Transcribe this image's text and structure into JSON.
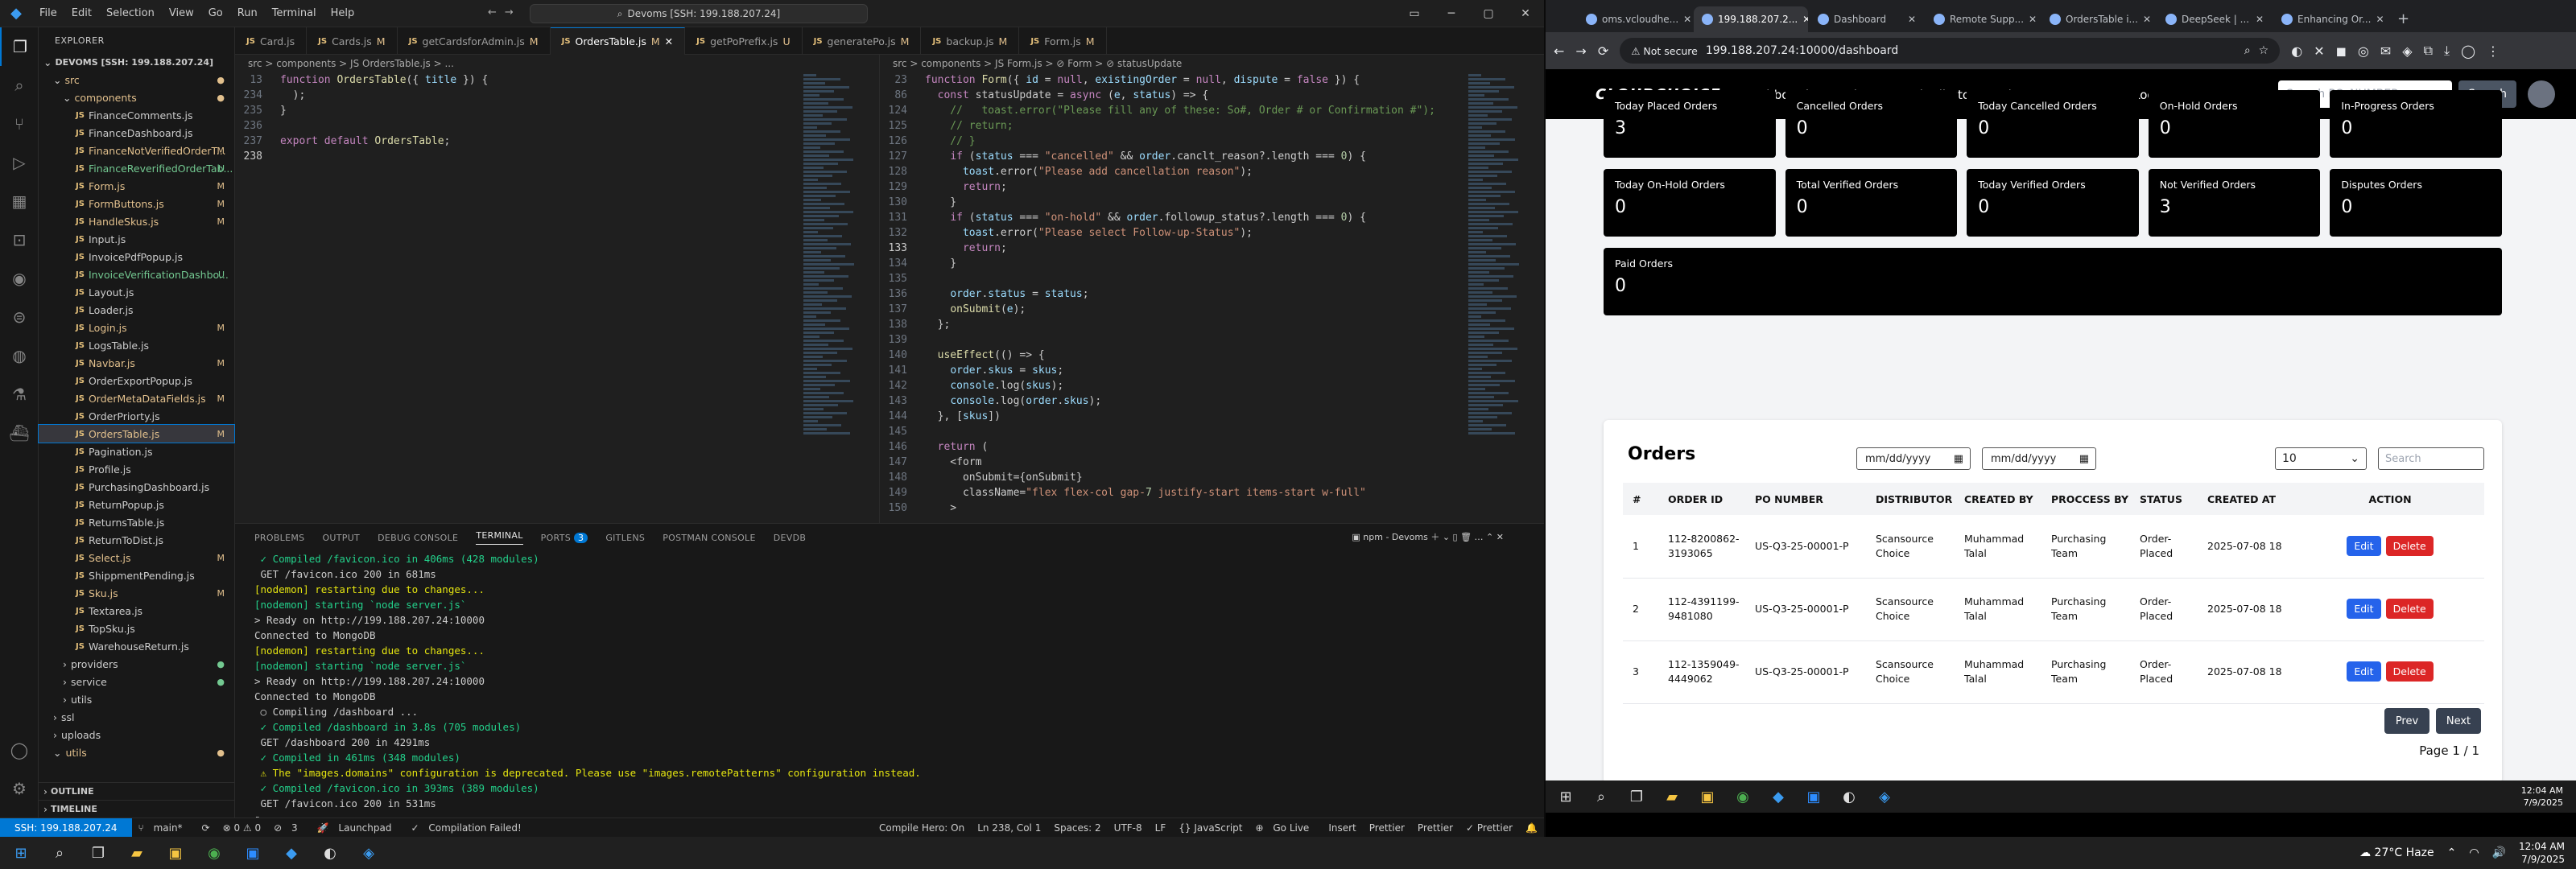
{
  "vscode": {
    "menu": [
      "File",
      "Edit",
      "Selection",
      "View",
      "Go",
      "Run",
      "Terminal",
      "Help"
    ],
    "command_center": "Devoms [SSH: 199.188.207.24]",
    "explorer": {
      "header": "EXPLORER",
      "root": "DEVOMS [SSH: 199.188.207.24]",
      "folders": {
        "src": "src",
        "components": "components"
      },
      "files": [
        {
          "name": "FinanceComments.js",
          "badge": ""
        },
        {
          "name": "FinanceDashboard.js",
          "badge": ""
        },
        {
          "name": "FinanceNotVerifiedOrderT...",
          "badge": "M"
        },
        {
          "name": "FinanceReverifiedOrderTab...",
          "badge": "U"
        },
        {
          "name": "Form.js",
          "badge": "M"
        },
        {
          "name": "FormButtons.js",
          "badge": "M"
        },
        {
          "name": "HandleSkus.js",
          "badge": "M"
        },
        {
          "name": "Input.js",
          "badge": ""
        },
        {
          "name": "InvoicePdfPopup.js",
          "badge": ""
        },
        {
          "name": "InvoiceVerificationDashbo...",
          "badge": "U"
        },
        {
          "name": "Layout.js",
          "badge": ""
        },
        {
          "name": "Loader.js",
          "badge": ""
        },
        {
          "name": "Login.js",
          "badge": "M"
        },
        {
          "name": "LogsTable.js",
          "badge": ""
        },
        {
          "name": "Navbar.js",
          "badge": "M"
        },
        {
          "name": "OrderExportPopup.js",
          "badge": ""
        },
        {
          "name": "OrderMetaDataFields.js",
          "badge": "M"
        },
        {
          "name": "OrderPriorty.js",
          "badge": ""
        },
        {
          "name": "OrdersTable.js",
          "badge": "M"
        },
        {
          "name": "Pagination.js",
          "badge": ""
        },
        {
          "name": "Profile.js",
          "badge": ""
        },
        {
          "name": "PurchasingDashboard.js",
          "badge": ""
        },
        {
          "name": "ReturnPopup.js",
          "badge": ""
        },
        {
          "name": "ReturnsTable.js",
          "badge": ""
        },
        {
          "name": "ReturnToDist.js",
          "badge": ""
        },
        {
          "name": "Select.js",
          "badge": "M"
        },
        {
          "name": "ShippmentPending.js",
          "badge": ""
        },
        {
          "name": "Sku.js",
          "badge": "M"
        },
        {
          "name": "Textarea.js",
          "badge": ""
        },
        {
          "name": "TopSku.js",
          "badge": ""
        },
        {
          "name": "WarehouseReturn.js",
          "badge": ""
        }
      ],
      "after": [
        "providers",
        "service",
        "utils",
        "ssl",
        "uploads",
        "utils"
      ],
      "outline": "OUTLINE",
      "timeline": "TIMELINE"
    },
    "tabs": [
      {
        "label": "Card.js",
        "mod": ""
      },
      {
        "label": "Cards.js",
        "mod": "M"
      },
      {
        "label": "getCardsforAdmin.js",
        "mod": "M"
      },
      {
        "label": "OrdersTable.js",
        "mod": "M"
      },
      {
        "label": "getPoPrefix.js",
        "mod": "U"
      },
      {
        "label": "generatePo.js",
        "mod": "M"
      },
      {
        "label": "backup.js",
        "mod": "M"
      },
      {
        "label": "Form.js",
        "mod": "M"
      }
    ],
    "left_breadcrumb": "src > components > JS OrdersTable.js > ...",
    "right_breadcrumb": "src > components > JS Form.js > ⊘ Form > ⊘ statusUpdate",
    "left_code_lines": [
      {
        "n": "13",
        "text": "function OrdersTable({ title }) {"
      },
      {
        "n": "234",
        "text": "  );"
      },
      {
        "n": "235",
        "text": "}"
      },
      {
        "n": "236",
        "text": ""
      },
      {
        "n": "237",
        "text": "export default OrdersTable;"
      },
      {
        "n": "238",
        "text": ""
      }
    ],
    "right_code_lines": [
      {
        "n": "23",
        "text": "function Form({ id = null, existingOrder = null, dispute = false }) {"
      },
      {
        "n": "86",
        "text": "  const statusUpdate = async (e, status) => {"
      },
      {
        "n": "124",
        "text": "    //   toast.error(\"Please fill any of these: So#, Order # or Confirmation #\");"
      },
      {
        "n": "125",
        "text": "    // return;"
      },
      {
        "n": "126",
        "text": "    // }"
      },
      {
        "n": "127",
        "text": "    if (status === \"cancelled\" && order.canclt_reason?.length === 0) {"
      },
      {
        "n": "128",
        "text": "      toast.error(\"Please add cancellation reason\");"
      },
      {
        "n": "129",
        "text": "      return;"
      },
      {
        "n": "130",
        "text": "    }"
      },
      {
        "n": "131",
        "text": "    if (status === \"on-hold\" && order.followup_status?.length === 0) {"
      },
      {
        "n": "132",
        "text": "      toast.error(\"Please select Follow-up-Status\");"
      },
      {
        "n": "133",
        "text": "      return;"
      },
      {
        "n": "134",
        "text": "    }"
      },
      {
        "n": "135",
        "text": ""
      },
      {
        "n": "136",
        "text": "    order.status = status;"
      },
      {
        "n": "137",
        "text": "    onSubmit(e);"
      },
      {
        "n": "138",
        "text": "  };"
      },
      {
        "n": "139",
        "text": ""
      },
      {
        "n": "140",
        "text": "  useEffect(() => {"
      },
      {
        "n": "141",
        "text": "    order.skus = skus;"
      },
      {
        "n": "142",
        "text": "    console.log(skus);"
      },
      {
        "n": "143",
        "text": "    console.log(order.skus);"
      },
      {
        "n": "144",
        "text": "  }, [skus])"
      },
      {
        "n": "145",
        "text": ""
      },
      {
        "n": "146",
        "text": "  return ("
      },
      {
        "n": "147",
        "text": "    <form"
      },
      {
        "n": "148",
        "text": "      onSubmit={onSubmit}"
      },
      {
        "n": "149",
        "text": "      className=\"flex flex-col gap-7 justify-start items-start w-full\""
      },
      {
        "n": "150",
        "text": "    >"
      }
    ],
    "panel_tabs": [
      "PROBLEMS",
      "OUTPUT",
      "DEBUG CONSOLE",
      "TERMINAL",
      "PORTS",
      "GITLENS",
      "POSTMAN CONSOLE",
      "DEVDB"
    ],
    "ports_count": "3",
    "terminal_label": "npm - Devoms",
    "terminal_lines": [
      {
        "text": " ✓ Compiled /favicon.ico in 406ms (428 modules)",
        "c": "gr"
      },
      {
        "text": " GET /favicon.ico 200 in 681ms",
        "c": ""
      },
      {
        "text": "[nodemon] restarting due to changes...",
        "c": "yl"
      },
      {
        "text": "[nodemon] starting `node server.js`",
        "c": "gr"
      },
      {
        "text": "> Ready on http://199.188.207.24:10000",
        "c": ""
      },
      {
        "text": "Connected to MongoDB",
        "c": ""
      },
      {
        "text": "[nodemon] restarting due to changes...",
        "c": "yl"
      },
      {
        "text": "[nodemon] starting `node server.js`",
        "c": "gr"
      },
      {
        "text": "> Ready on http://199.188.207.24:10000",
        "c": ""
      },
      {
        "text": "Connected to MongoDB",
        "c": ""
      },
      {
        "text": " ○ Compiling /dashboard ...",
        "c": ""
      },
      {
        "text": " ✓ Compiled /dashboard in 3.8s (705 modules)",
        "c": "gr"
      },
      {
        "text": " GET /dashboard 200 in 4291ms",
        "c": ""
      },
      {
        "text": " ✓ Compiled in 461ms (348 modules)",
        "c": "gr"
      },
      {
        "text": " ⚠ The \"images.domains\" configuration is deprecated. Please use \"images.remotePatterns\" configuration instead.",
        "c": "yl"
      },
      {
        "text": " ✓ Compiled /favicon.ico in 393ms (389 modules)",
        "c": "gr"
      },
      {
        "text": " GET /favicon.ico 200 in 531ms",
        "c": ""
      },
      {
        "text": "▯",
        "c": ""
      }
    ],
    "statusbar": {
      "remote": "SSH: 199.188.207.24",
      "branch": "main*",
      "sync": "⟳",
      "errors": "⊗ 0 ⚠ 0",
      "info": "3",
      "launch": "Launchpad",
      "compile": "Compilation Failed!",
      "hero": "Compile Hero: On",
      "pos": "Ln 238, Col 1",
      "spaces": "Spaces: 2",
      "enc": "UTF-8",
      "eol": "LF",
      "lang": "{} JavaScript",
      "golive": "Go Live",
      "insert": "Insert",
      "prettier1": "Prettier",
      "prettier2": "Prettier",
      "prettier3": "✓ Prettier"
    }
  },
  "chrome": {
    "tabs": [
      {
        "label": "oms.vcloudhe..."
      },
      {
        "label": "199.188.207.2..."
      },
      {
        "label": "Dashboard"
      },
      {
        "label": "Remote Supp..."
      },
      {
        "label": "OrdersTable i..."
      },
      {
        "label": "DeepSeek | ..."
      },
      {
        "label": "Enhancing Or..."
      }
    ],
    "not_secure": "Not secure",
    "url": "199.188.207.24:10000/dashboard"
  },
  "app": {
    "brand": "CLOUDCHOICE",
    "nav": [
      "Dashboard",
      "Employees",
      "Distributors",
      "Disputes",
      "Returns",
      "Logs"
    ],
    "search_placeholder": "Search PO_NUMBER...",
    "search_button": "Search",
    "cards_row1": [
      {
        "label": "Today Placed Orders",
        "value": "3"
      },
      {
        "label": "Cancelled Orders",
        "value": "0"
      },
      {
        "label": "Today Cancelled Orders",
        "value": "0"
      },
      {
        "label": "On-Hold Orders",
        "value": "0"
      },
      {
        "label": "In-Progress Orders",
        "value": "0"
      }
    ],
    "cards_row2": [
      {
        "label": "Today On-Hold Orders",
        "value": "0"
      },
      {
        "label": "Total Verified Orders",
        "value": "0"
      },
      {
        "label": "Today Verified Orders",
        "value": "0"
      },
      {
        "label": "Not Verified Orders",
        "value": "3"
      },
      {
        "label": "Disputes Orders",
        "value": "0"
      }
    ],
    "paid": {
      "label": "Paid Orders",
      "value": "0"
    },
    "orders": {
      "title": "Orders",
      "date_placeholder": "mm/dd/yyyy",
      "page_size": "10",
      "search_placeholder": "Search",
      "columns": [
        "#",
        "ORDER ID",
        "PO NUMBER",
        "DISTRIBUTOR",
        "CREATED BY",
        "PROCCESS BY",
        "STATUS",
        "CREATED AT",
        "ACTION"
      ],
      "rows": [
        {
          "n": "1",
          "order_id": "112-8200862-3193065",
          "po": "US-Q3-25-00001-P",
          "dist": "Scansource Choice",
          "by": "Muhammad Talal",
          "proc": "Purchasing Team",
          "status": "Order-Placed",
          "at": "2025-07-08 18"
        },
        {
          "n": "2",
          "order_id": "112-4391199-9481080",
          "po": "US-Q3-25-00001-P",
          "dist": "Scansource Choice",
          "by": "Muhammad Talal",
          "proc": "Purchasing Team",
          "status": "Order-Placed",
          "at": "2025-07-08 18"
        },
        {
          "n": "3",
          "order_id": "112-1359049-4449062",
          "po": "US-Q3-25-00001-P",
          "dist": "Scansource Choice",
          "by": "Muhammad Talal",
          "proc": "Purchasing Team",
          "status": "Order-Placed",
          "at": "2025-07-08 18"
        }
      ],
      "edit": "Edit",
      "delete": "Delete",
      "prev": "Prev",
      "next": "Next",
      "page_info": "Page 1 / 1"
    }
  },
  "right_taskbar_clock": {
    "time": "12:04 AM",
    "date": "7/9/2025"
  },
  "bottom_taskbar": {
    "weather": "27°C Haze",
    "time": "12:04 AM",
    "date": "7/9/2025"
  }
}
